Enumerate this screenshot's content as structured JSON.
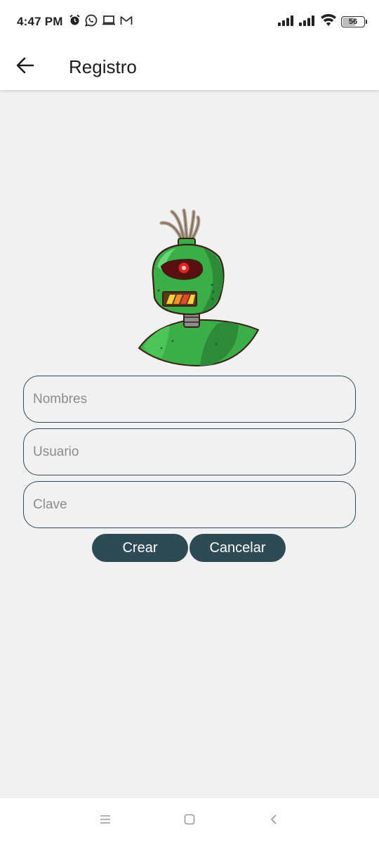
{
  "status_bar": {
    "time": "4:47 PM",
    "icons": [
      "alarm-icon",
      "whatsapp-icon",
      "laptop-icon",
      "gmail-icon"
    ],
    "battery": "56",
    "signal_icons": [
      "signal-icon",
      "signal-icon",
      "wifi-icon"
    ]
  },
  "app_bar": {
    "title": "Registro",
    "back_icon": "arrow-left-icon"
  },
  "illustration": {
    "icon": "robot-illustration"
  },
  "form": {
    "nombres_placeholder": "Nombres",
    "usuario_placeholder": "Usuario",
    "clave_placeholder": "Clave",
    "nombres_value": "",
    "usuario_value": "",
    "clave_value": ""
  },
  "buttons": {
    "crear_label": "Crear",
    "cancelar_label": "Cancelar"
  },
  "nav_bar": {
    "icons": [
      "menu-icon",
      "home-square-icon",
      "back-chevron-icon"
    ]
  },
  "colors": {
    "accent": "#2e4a55",
    "background": "#f1f1f1",
    "robot_green": "#3cae48"
  }
}
